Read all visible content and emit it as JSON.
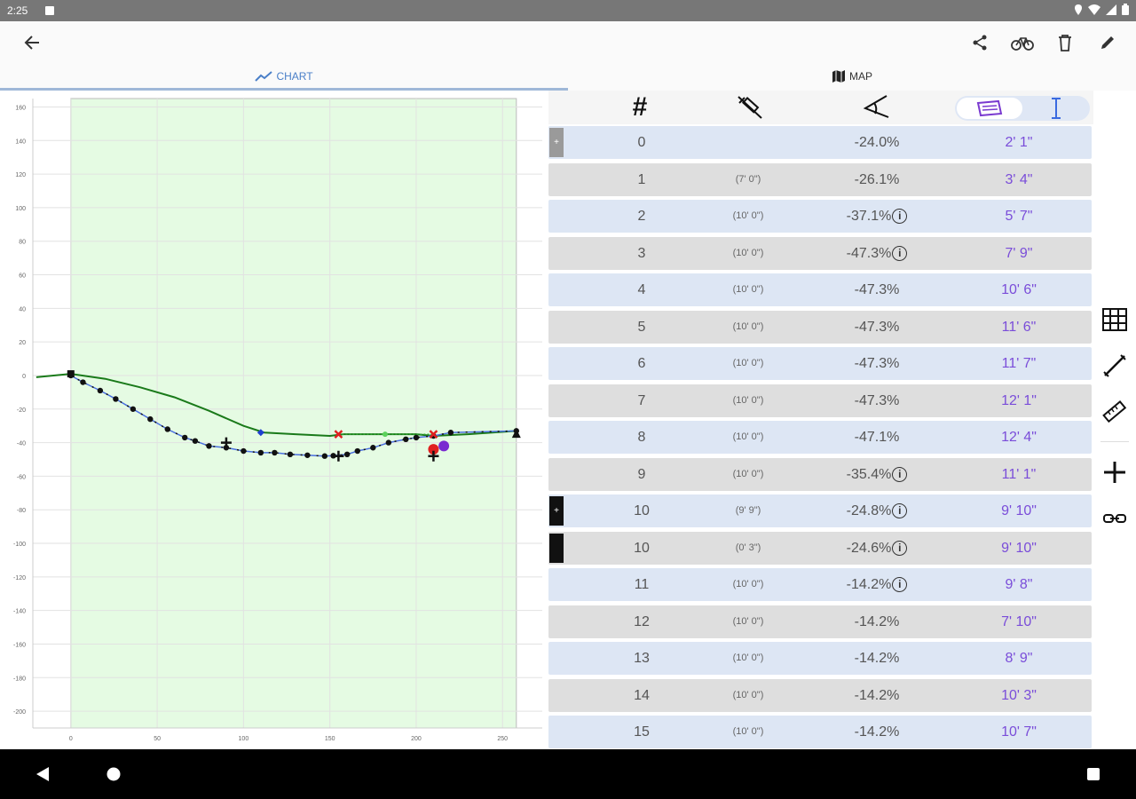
{
  "status_bar": {
    "time": "2:25"
  },
  "tabs": [
    {
      "label": "CHART",
      "icon": "line-chart-icon"
    },
    {
      "label": "MAP",
      "icon": "map-icon"
    }
  ],
  "toolbar": {
    "icons": [
      "back-arrow-icon",
      "share-icon",
      "bicycle-icon",
      "trash-icon",
      "pencil-icon"
    ]
  },
  "table": {
    "header": {
      "col_number": "#",
      "col_length": "length-icon",
      "col_slope": "angle-icon",
      "col_toggle_on": "car-icon",
      "col_toggle_off": "vertical-measure-icon"
    },
    "rows": [
      {
        "num": "0",
        "length": "",
        "slope": "-24.0%",
        "depth": "2' 1\"",
        "info": false,
        "style": "blue",
        "handle": "gray"
      },
      {
        "num": "1",
        "length": "(7' 0\")",
        "slope": "-26.1%",
        "depth": "3' 4\"",
        "info": false,
        "style": "gray",
        "handle": ""
      },
      {
        "num": "2",
        "length": "(10' 0\")",
        "slope": "-37.1%",
        "depth": "5' 7\"",
        "info": true,
        "style": "blue",
        "handle": ""
      },
      {
        "num": "3",
        "length": "(10' 0\")",
        "slope": "-47.3%",
        "depth": "7' 9\"",
        "info": true,
        "style": "gray",
        "handle": ""
      },
      {
        "num": "4",
        "length": "(10' 0\")",
        "slope": "-47.3%",
        "depth": "10' 6\"",
        "info": false,
        "style": "blue",
        "handle": ""
      },
      {
        "num": "5",
        "length": "(10' 0\")",
        "slope": "-47.3%",
        "depth": "11' 6\"",
        "info": false,
        "style": "gray",
        "handle": ""
      },
      {
        "num": "6",
        "length": "(10' 0\")",
        "slope": "-47.3%",
        "depth": "11' 7\"",
        "info": false,
        "style": "blue",
        "handle": ""
      },
      {
        "num": "7",
        "length": "(10' 0\")",
        "slope": "-47.3%",
        "depth": "12' 1\"",
        "info": false,
        "style": "gray",
        "handle": ""
      },
      {
        "num": "8",
        "length": "(10' 0\")",
        "slope": "-47.1%",
        "depth": "12' 4\"",
        "info": false,
        "style": "blue",
        "handle": ""
      },
      {
        "num": "9",
        "length": "(10' 0\")",
        "slope": "-35.4%",
        "depth": "11' 1\"",
        "info": true,
        "style": "gray",
        "handle": ""
      },
      {
        "num": "10",
        "length": "(9' 9\")",
        "slope": "-24.8%",
        "depth": "9' 10\"",
        "info": true,
        "style": "blue",
        "handle": "black"
      },
      {
        "num": "10",
        "length": "(0' 3\")",
        "slope": "-24.6%",
        "depth": "9' 10\"",
        "info": true,
        "style": "gray",
        "handle": "black"
      },
      {
        "num": "11",
        "length": "(10' 0\")",
        "slope": "-14.2%",
        "depth": "9' 8\"",
        "info": true,
        "style": "blue",
        "handle": ""
      },
      {
        "num": "12",
        "length": "(10' 0\")",
        "slope": "-14.2%",
        "depth": "7' 10\"",
        "info": false,
        "style": "gray",
        "handle": ""
      },
      {
        "num": "13",
        "length": "(10' 0\")",
        "slope": "-14.2%",
        "depth": "8' 9\"",
        "info": false,
        "style": "blue",
        "handle": ""
      },
      {
        "num": "14",
        "length": "(10' 0\")",
        "slope": "-14.2%",
        "depth": "10' 3\"",
        "info": false,
        "style": "gray",
        "handle": ""
      },
      {
        "num": "15",
        "length": "(10' 0\")",
        "slope": "-14.2%",
        "depth": "10' 7\"",
        "info": false,
        "style": "blue",
        "handle": ""
      }
    ]
  },
  "side_rail": {
    "icons": [
      "grid-icon",
      "measure-line-icon",
      "ruler-icon",
      "add-icon",
      "link-icon"
    ]
  },
  "chart_data": {
    "type": "line",
    "title": "",
    "xlabel": "",
    "ylabel": "",
    "xlim": [
      -22,
      273
    ],
    "ylim": [
      -210,
      165
    ],
    "x_ticks": [
      0,
      50,
      100,
      150,
      200,
      250
    ],
    "y_ticks": [
      160,
      140,
      120,
      100,
      80,
      60,
      40,
      20,
      0,
      -20,
      -40,
      -60,
      -80,
      -100,
      -120,
      -140,
      -160,
      -180,
      -200
    ],
    "shaded_region": {
      "x": [
        0,
        258
      ],
      "color": "#e5fbe3"
    },
    "series": [
      {
        "style": "ground",
        "color": "#1a7a1a",
        "points": [
          [
            -20,
            -1
          ],
          [
            0,
            1
          ],
          [
            20,
            -2
          ],
          [
            40,
            -7
          ],
          [
            60,
            -13
          ],
          [
            80,
            -21
          ],
          [
            100,
            -30
          ],
          [
            112,
            -34
          ],
          [
            130,
            -35
          ],
          [
            150,
            -36
          ],
          [
            158,
            -35
          ],
          [
            180,
            -35
          ],
          [
            200,
            -35
          ],
          [
            210,
            -36
          ],
          [
            230,
            -35
          ],
          [
            258,
            -33
          ]
        ]
      },
      {
        "style": "pipe",
        "color": "#4a6fe0",
        "points": [
          [
            0,
            0
          ],
          [
            7,
            -4
          ],
          [
            17,
            -9
          ],
          [
            26,
            -14
          ],
          [
            36,
            -20
          ],
          [
            46,
            -26
          ],
          [
            56,
            -32
          ],
          [
            66,
            -37
          ],
          [
            72,
            -39
          ],
          [
            80,
            -42
          ],
          [
            90,
            -43
          ],
          [
            100,
            -45
          ],
          [
            110,
            -46
          ],
          [
            118,
            -46
          ],
          [
            127,
            -47
          ],
          [
            137,
            -47.5
          ],
          [
            147,
            -48
          ],
          [
            152,
            -47.8
          ],
          [
            160,
            -47
          ],
          [
            166,
            -45
          ],
          [
            175,
            -43
          ],
          [
            184,
            -40
          ],
          [
            194,
            -38
          ],
          [
            200,
            -37
          ],
          [
            210,
            -36
          ],
          [
            220,
            -34
          ],
          [
            258,
            -33
          ]
        ]
      }
    ],
    "markers": [
      {
        "x": 110,
        "y": -34,
        "kind": "diamond",
        "color": "#1f3fd0"
      },
      {
        "x": 155,
        "y": -35,
        "kind": "cross",
        "color": "#e02020"
      },
      {
        "x": 182,
        "y": -35,
        "kind": "dot",
        "color": "#5cd15c"
      },
      {
        "x": 210,
        "y": -35,
        "kind": "cross",
        "color": "#e02020"
      },
      {
        "x": 210,
        "y": -44,
        "kind": "circle",
        "color": "#e02020"
      },
      {
        "x": 216,
        "y": -42,
        "kind": "circle",
        "color": "#7a2ad0"
      },
      {
        "x": 90,
        "y": -40,
        "kind": "plus",
        "color": "#111"
      },
      {
        "x": 155,
        "y": -48,
        "kind": "plus",
        "color": "#111"
      },
      {
        "x": 210,
        "y": -48,
        "kind": "plus",
        "color": "#111"
      },
      {
        "x": 258,
        "y": -35,
        "kind": "triangle",
        "color": "#111"
      },
      {
        "x": 0,
        "y": 1,
        "kind": "square",
        "color": "#111"
      }
    ]
  }
}
